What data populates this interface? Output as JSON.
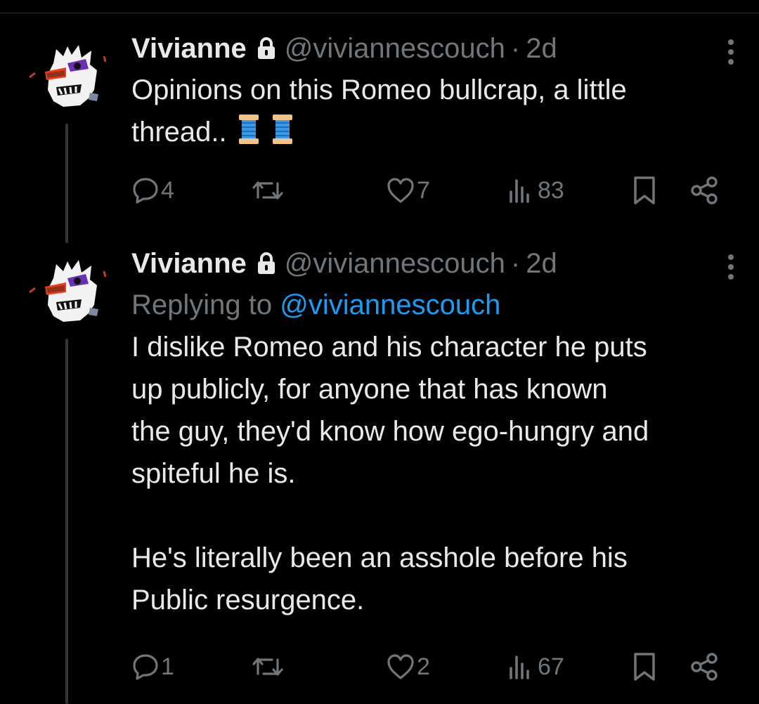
{
  "tweets": [
    {
      "name": "Vivianne",
      "handle": "@viviannescouch",
      "separator": "·",
      "time": "2d",
      "text": "Opinions on this Romeo bullcrap, a little\nthread..",
      "emoji": [
        "spool-of-thread",
        "spool-of-thread"
      ],
      "replies": "4",
      "likes": "7",
      "views": "83"
    },
    {
      "name": "Vivianne",
      "handle": "@viviannescouch",
      "separator": "·",
      "time": "2d",
      "replying_prefix": "Replying to",
      "replying_to": "@viviannescouch",
      "text": "I dislike Romeo and his character he puts\nup publicly, for anyone that has known\nthe guy, they'd know how ego-hungry and\nspiteful he is.\n\nHe's literally been an asshole before his\nPublic resurgence.",
      "replies": "1",
      "likes": "2",
      "views": "67"
    }
  ],
  "colors": {
    "background": "#000000",
    "text": "#e7e9ea",
    "muted": "#71767b",
    "accent": "#1d9bf0",
    "thread_line": "#333639"
  }
}
